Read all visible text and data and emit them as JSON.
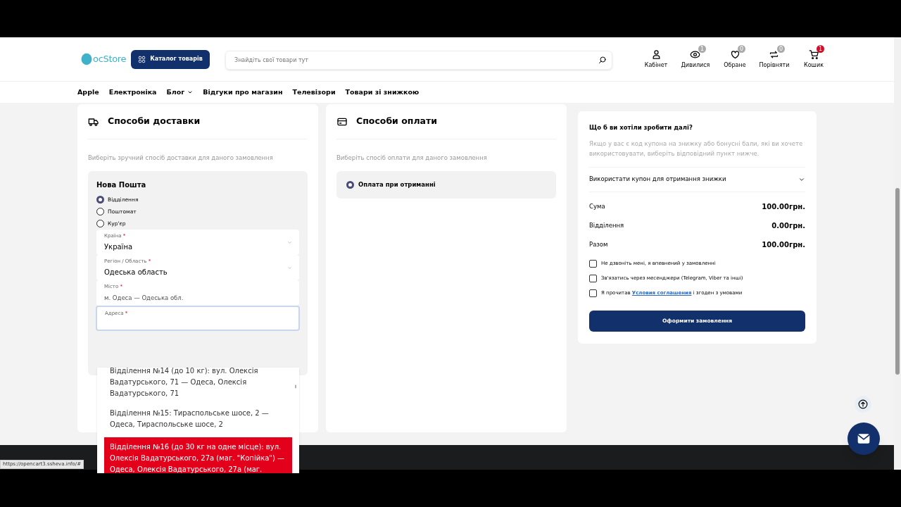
{
  "header": {
    "logo": "ocStore",
    "catalog_button": "Каталог товарів",
    "search": {
      "placeholder": "Знайдіть свої товари тут"
    },
    "actions": [
      {
        "kind": "user",
        "label": "Кабінет"
      },
      {
        "kind": "eye",
        "label": "Дивилися",
        "count": "1",
        "highlight": false
      },
      {
        "kind": "heart",
        "label": "Обране",
        "count": "0",
        "highlight": false
      },
      {
        "kind": "compare",
        "label": "Порівняти",
        "count": "0",
        "highlight": false
      },
      {
        "kind": "cart",
        "label": "Кошик",
        "count": "1",
        "highlight": true
      }
    ]
  },
  "nav": [
    {
      "label": "Apple",
      "dropdown": false
    },
    {
      "label": "Електроніка",
      "dropdown": false
    },
    {
      "label": "Блог",
      "dropdown": true
    },
    {
      "label": "Відгуки про магазин",
      "dropdown": false
    },
    {
      "label": "Телевізори",
      "dropdown": false
    },
    {
      "label": "Товари зі знижкою",
      "dropdown": false
    }
  ],
  "delivery": {
    "title": "Способи доставки",
    "hint": "Виберіть зручний спосіб доставки для даного замовлення",
    "carrier": "Нова Пошта",
    "options": [
      {
        "label": "Відділення",
        "selected": true
      },
      {
        "label": "Поштомат",
        "selected": false
      },
      {
        "label": "Кур'єр",
        "selected": false
      }
    ],
    "fields": [
      {
        "kind": "select",
        "label": "Країна",
        "mark": "*",
        "value": "Україна",
        "focused": false
      },
      {
        "kind": "select",
        "label": "Регіон / Область",
        "mark": "*",
        "value": "Одеська область",
        "focused": false
      },
      {
        "kind": "text",
        "label": "Місто",
        "mark": "*",
        "value": "м. Одеса — Одеська обл.",
        "focused": false
      },
      {
        "kind": "text",
        "label": "Адреса",
        "mark": "*",
        "focused": true
      }
    ],
    "suggestions": [
      {
        "text": "Відділення №14 (до 10 кг): вул. Олексія Вадатурського, 71 — Одеса, Олексія Вадатурського, 71",
        "selected": false
      },
      {
        "text": "Відділення №15: Тираспольське шосе, 2 — Одеса, Тираспольське шосе, 2",
        "selected": false
      },
      {
        "text": "Відділення №16 (до 30 кг на одне місце): вул. Олексія Вадатурського, 27а (маг. \"Копійка\") — Одеса, Олексія Вадатурського, 27а (маг.",
        "selected": true
      }
    ]
  },
  "payment": {
    "title": "Способи оплати",
    "hint": "Виберіть спосіб оплати для даного замовлення",
    "options": [
      {
        "label": "Оплата при отриманні",
        "selected": true
      }
    ]
  },
  "summary": {
    "title": "Що б ви хотіли зробити далі?",
    "hint": "Якщо у вас є код купона на знижку або бонусні бали, які ви хочете використовувати, виберіть відповідний пункт нижче.",
    "coupon": "Використати купон для отримання знижки",
    "totals": [
      {
        "label": "Сума",
        "value": "100.00грн."
      },
      {
        "label": "Відділення",
        "value": "0.00грн."
      },
      {
        "label": "Разом",
        "value": "100.00грн."
      }
    ],
    "checks": [
      {
        "text": "Не дзвоніть мені, я впевнений у замовленні",
        "checked": false
      },
      {
        "text": "Зв'язатись через месенджери (Telegram, Viber та інші)",
        "checked": false
      },
      {
        "text": "Я прочитав",
        "link": "Условия соглашения",
        "after": "і згоден з умовами",
        "checked": false
      }
    ],
    "submit": "Оформити замовлення"
  },
  "status_url": "https://opencart3.ssheva.info/#"
}
